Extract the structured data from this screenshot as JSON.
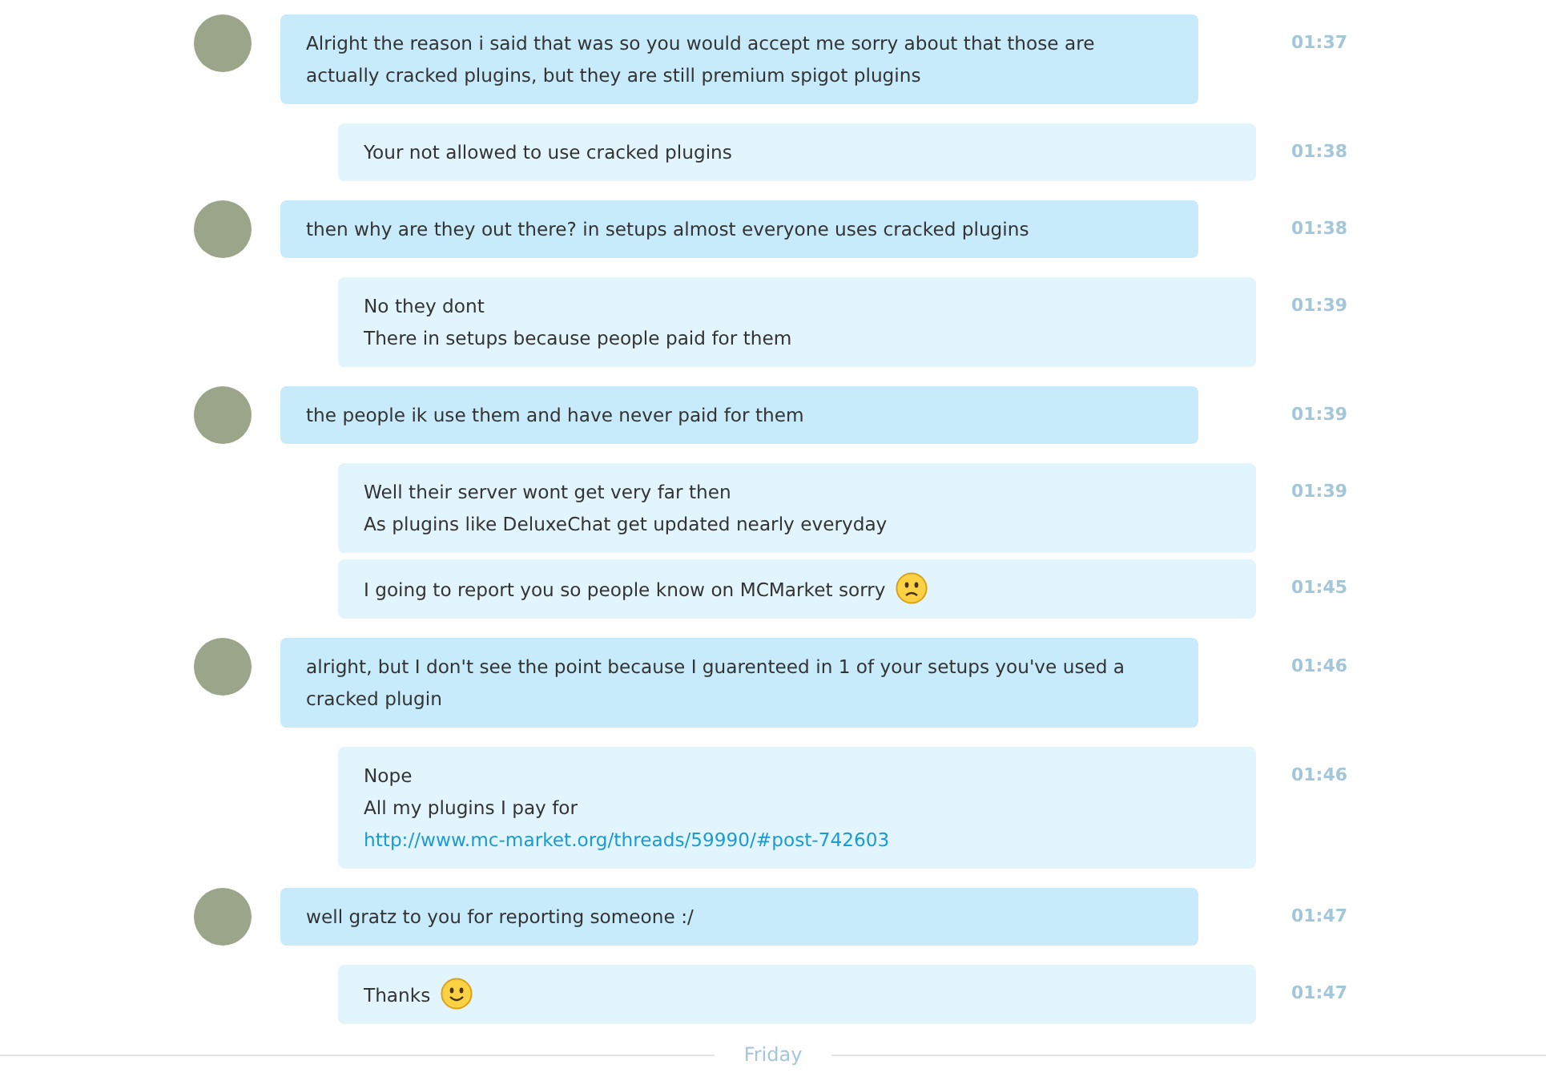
{
  "messages": [
    {
      "kind": "incoming",
      "time": "01:37",
      "lines": [
        {
          "kind": "text",
          "text": "Alright the reason i said that was so you would accept me sorry about that those are actually cracked plugins, but they are still premium spigot plugins"
        }
      ]
    },
    {
      "kind": "outgoing",
      "time": "01:38",
      "lines": [
        {
          "kind": "text",
          "text": "Your not allowed to use cracked plugins"
        }
      ]
    },
    {
      "kind": "incoming",
      "time": "01:38",
      "lines": [
        {
          "kind": "text",
          "text": "then why are they out there? in setups almost everyone uses cracked plugins"
        }
      ]
    },
    {
      "kind": "outgoing",
      "time": "01:39",
      "lines": [
        {
          "kind": "text",
          "text": "No they dont"
        },
        {
          "kind": "text",
          "text": "There in setups because people paid for them"
        }
      ]
    },
    {
      "kind": "incoming",
      "time": "01:39",
      "lines": [
        {
          "kind": "text",
          "text": "the people ik use them and have never paid for them"
        }
      ]
    },
    {
      "kind": "outgoing",
      "time": "01:39",
      "lines": [
        {
          "kind": "text",
          "text": "Well their server wont get very far then"
        },
        {
          "kind": "text",
          "text": "As plugins like DeluxeChat get updated nearly everyday"
        }
      ]
    },
    {
      "kind": "outgoing",
      "time": "01:45",
      "lines": [
        {
          "kind": "text_frown_emoji",
          "text": "I going to report you so people know on MCMarket sorry"
        }
      ]
    },
    {
      "kind": "incoming",
      "time": "01:46",
      "lines": [
        {
          "kind": "text",
          "text": "alright, but I don't see the point because I guarenteed in 1 of your setups you've used a cracked plugin"
        }
      ]
    },
    {
      "kind": "outgoing",
      "time": "01:46",
      "lines": [
        {
          "kind": "text",
          "text": "Nope"
        },
        {
          "kind": "text",
          "text": "All my plugins I pay for"
        },
        {
          "kind": "link",
          "text": "http://www.mc-market.org/threads/59990/#post-742603"
        }
      ]
    },
    {
      "kind": "incoming",
      "time": "01:47",
      "lines": [
        {
          "kind": "text",
          "text": "well gratz to you for reporting someone :/"
        }
      ]
    },
    {
      "kind": "outgoing",
      "time": "01:47",
      "lines": [
        {
          "kind": "text_smile_emoji",
          "text": "Thanks"
        }
      ]
    }
  ],
  "day_divider": "Friday"
}
